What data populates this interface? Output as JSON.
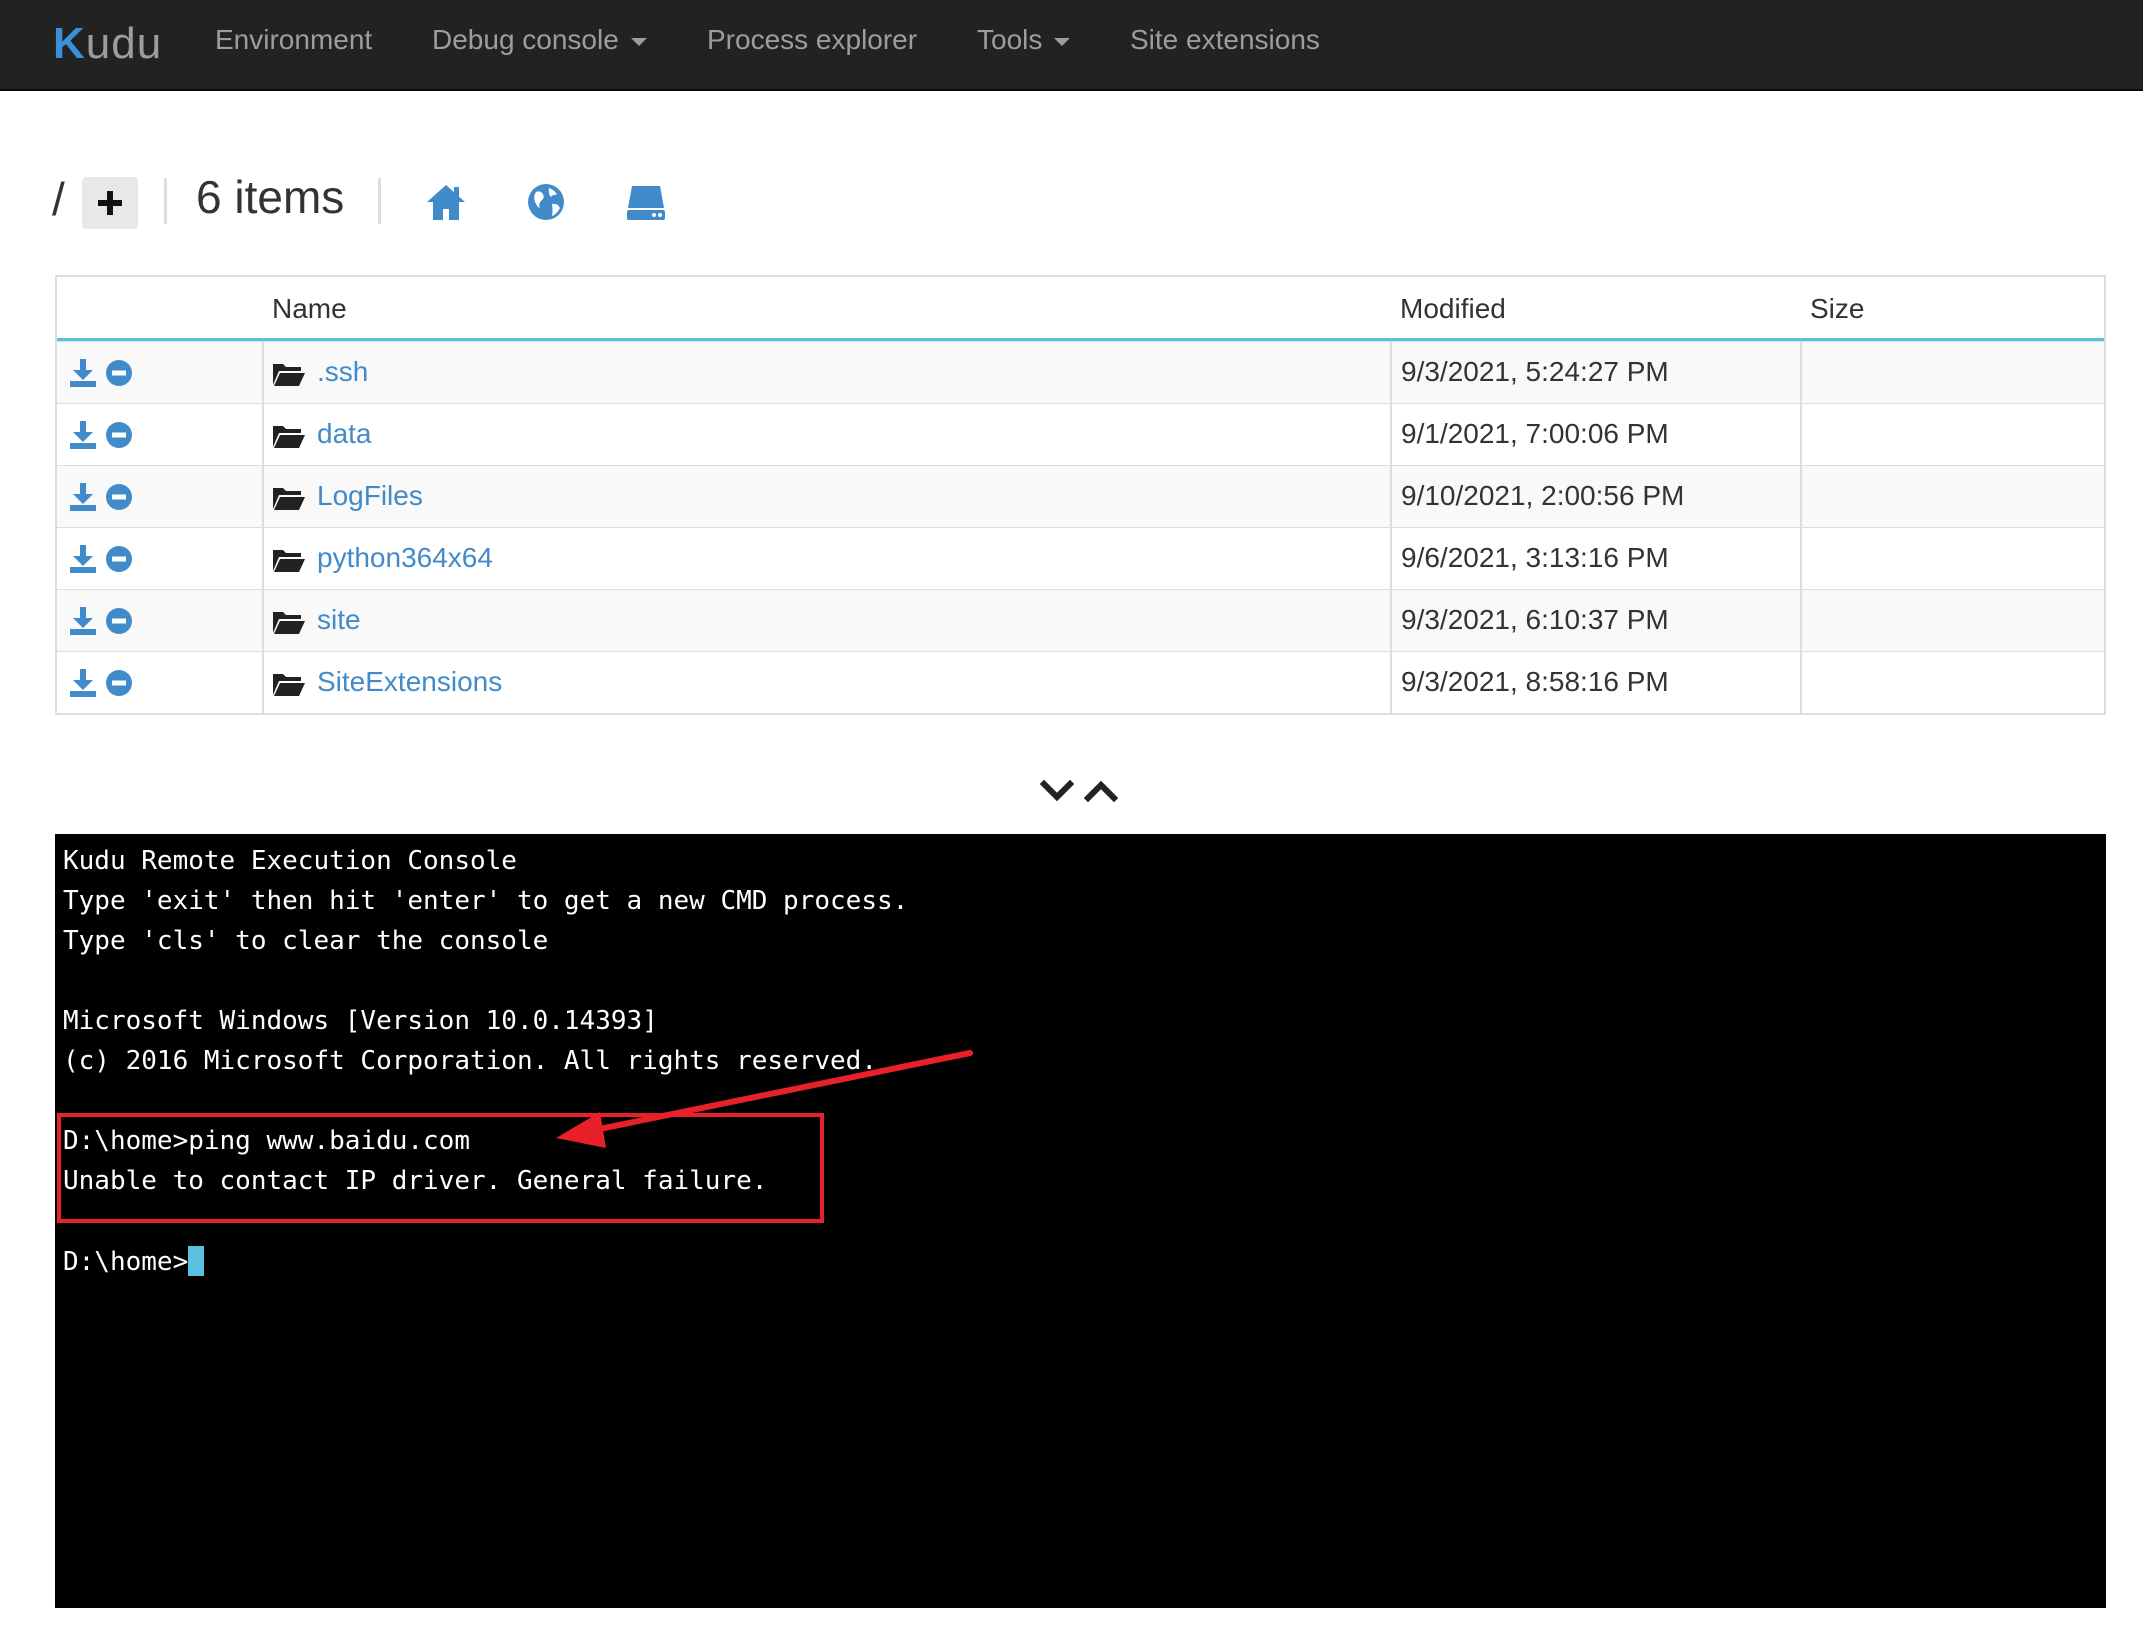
{
  "navbar": {
    "brand": "Kudu",
    "items": [
      {
        "label": "Environment",
        "dropdown": false
      },
      {
        "label": "Debug console",
        "dropdown": true
      },
      {
        "label": "Process explorer",
        "dropdown": false
      },
      {
        "label": "Tools",
        "dropdown": true
      },
      {
        "label": "Site extensions",
        "dropdown": false
      }
    ]
  },
  "toolbar": {
    "path": "/",
    "item_count": "6 items",
    "icons": [
      "plus-icon",
      "home-icon",
      "globe-icon",
      "drive-icon"
    ]
  },
  "table": {
    "headers": {
      "name": "Name",
      "modified": "Modified",
      "size": "Size"
    },
    "rows": [
      {
        "name": ".ssh",
        "modified": "9/3/2021, 5:24:27 PM",
        "size": ""
      },
      {
        "name": "data",
        "modified": "9/1/2021, 7:00:06 PM",
        "size": ""
      },
      {
        "name": "LogFiles",
        "modified": "9/10/2021, 2:00:56 PM",
        "size": ""
      },
      {
        "name": "python364x64",
        "modified": "9/6/2021, 3:13:16 PM",
        "size": ""
      },
      {
        "name": "site",
        "modified": "9/3/2021, 6:10:37 PM",
        "size": ""
      },
      {
        "name": "SiteExtensions",
        "modified": "9/3/2021, 8:58:16 PM",
        "size": ""
      }
    ]
  },
  "console": {
    "lines": [
      "Kudu Remote Execution Console",
      "Type 'exit' then hit 'enter' to get a new CMD process.",
      "Type 'cls' to clear the console",
      "",
      "Microsoft Windows [Version 10.0.14393]",
      "(c) 2016 Microsoft Corporation. All rights reserved.",
      "",
      "D:\\home>ping www.baidu.com",
      "Unable to contact IP driver. General failure.",
      "",
      "D:\\home>"
    ]
  },
  "colors": {
    "navbar_bg": "#222222",
    "nav_text": "#9d9d9d",
    "link": "#428bca",
    "header_border": "#5bc0de",
    "console_bg": "#000000",
    "cursor": "#5bc0de",
    "annotation": "#e8202a"
  }
}
